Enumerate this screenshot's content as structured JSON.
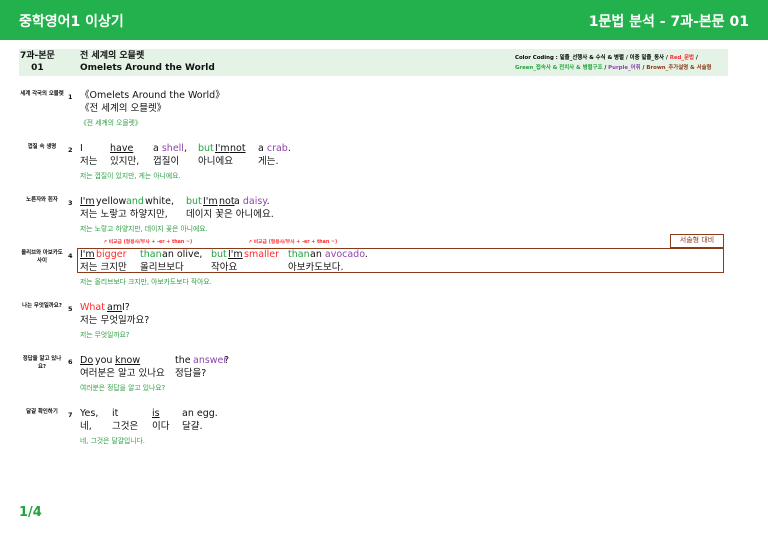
{
  "header": {
    "left_title": "중학영어1 이상기",
    "right_title": "1문법 분석 - 7과-본문 01"
  },
  "lesson": {
    "code_line1": "7과-본문",
    "code_line2": "01",
    "title_kr": "전 세계의 오믈렛",
    "title_en": "Omelets Around the World"
  },
  "color_coding": {
    "line1_prefix": "Color Coding : 밑줄_선행사 & 수식 & 병렬 / 이중 밑줄_동사 / ",
    "line1_red": "Red_문법",
    "line1_suffix": " /",
    "line2_green": "Green_접속사 & 전치사 & 병렬구조",
    "line2_sep1": " / ",
    "line2_purple": "Purple_어휘",
    "line2_sep2": " / ",
    "line2_brown": "Brown_추가설명 & 서술형",
    "colors": {
      "red": "#ff2a2a",
      "green": "#22a33c",
      "purple": "#8e44ad",
      "brown": "#8b3a1a"
    }
  },
  "rows": [
    {
      "label": "세계 각국의 오믈렛",
      "num": "1",
      "en": "《Omelets Around the World》",
      "kr": "《전 세계의 오믈렛》",
      "tr": "《전 세계의 오믈렛》"
    },
    {
      "label": "껍질 속 생명",
      "num": "2",
      "en": {
        "w1": "I",
        "w2": "have",
        "w3a": "a ",
        "w3b": "shell",
        "w3c": ",",
        "w4": "but",
        "w5": "I'm",
        "w6": "not",
        "w7a": "a ",
        "w7b": "crab",
        "w7c": "."
      },
      "kr": {
        "k1": "저는",
        "k2": "있지만,",
        "k3": "껍질이",
        "k4": "아니에요",
        "k5": "게는."
      },
      "tr": "저는 껍질이 있지만, 게는 아니에요."
    },
    {
      "label": "노른자와 흰자",
      "num": "3",
      "en": {
        "w1": "I'm",
        "w2": "yellow",
        "w3": "and",
        "w4": "white,",
        "w5": "but",
        "w6": "I'm",
        "w7": "not",
        "w8a": "a ",
        "w8b": "daisy",
        "w8c": "."
      },
      "kr": {
        "k1": "저는 노랗고 하얗지만,",
        "k2": "데이지 꽃은 아니에요."
      },
      "tr": "저는 노랗고 하얗지만, 데이지 꽃은 아니에요."
    },
    {
      "label": "올리브와 아보카도 사이",
      "num": "4",
      "note1": "비교급 (형용사/부사 + -er + than ~)",
      "note2": "비교급 (형용사/부사 + -er + than ~)",
      "tag": "서술형 대비",
      "en": {
        "w1": "I'm",
        "w2": "bigger",
        "w3": "than",
        "w4": "an olive,",
        "w5": "but",
        "w6": "I'm",
        "w7": "smaller",
        "w8": "than",
        "w9a": "an ",
        "w9b": "avocado",
        "w9c": "."
      },
      "kr": {
        "k1": "저는 크지만",
        "k2": "올리브보다",
        "k3": "작아요",
        "k4": "아보카도보다."
      },
      "tr": "저는 올리브보다 크지만, 아보카도보다 작아요."
    },
    {
      "label": "나는 무엇일까요?",
      "num": "5",
      "en": {
        "w1": "What",
        "w2": "am",
        "w3": "I?"
      },
      "kr": "저는 무엇일까요?",
      "tr": "저는 무엇일까요?"
    },
    {
      "label": "정답을 알고 있나요?",
      "num": "6",
      "en": {
        "w1": "Do",
        "w2": "you",
        "w3": "know",
        "w4": "the",
        "w5": "answer",
        "w6": "?"
      },
      "kr": {
        "k1": "여러분은 알고 있나요",
        "k2": "정답을?"
      },
      "tr": "여러분은 정답을 알고 있나요?"
    },
    {
      "label": "달걀 확인하기",
      "num": "7",
      "en": {
        "w1": "Yes,",
        "w2": "it",
        "w3": "is",
        "w4": "an egg."
      },
      "kr": {
        "k1": "네,",
        "k2": "그것은",
        "k3": "이다",
        "k4": "달걀."
      },
      "tr": "네, 그것은 달걀입니다."
    }
  ],
  "page": "1/4"
}
